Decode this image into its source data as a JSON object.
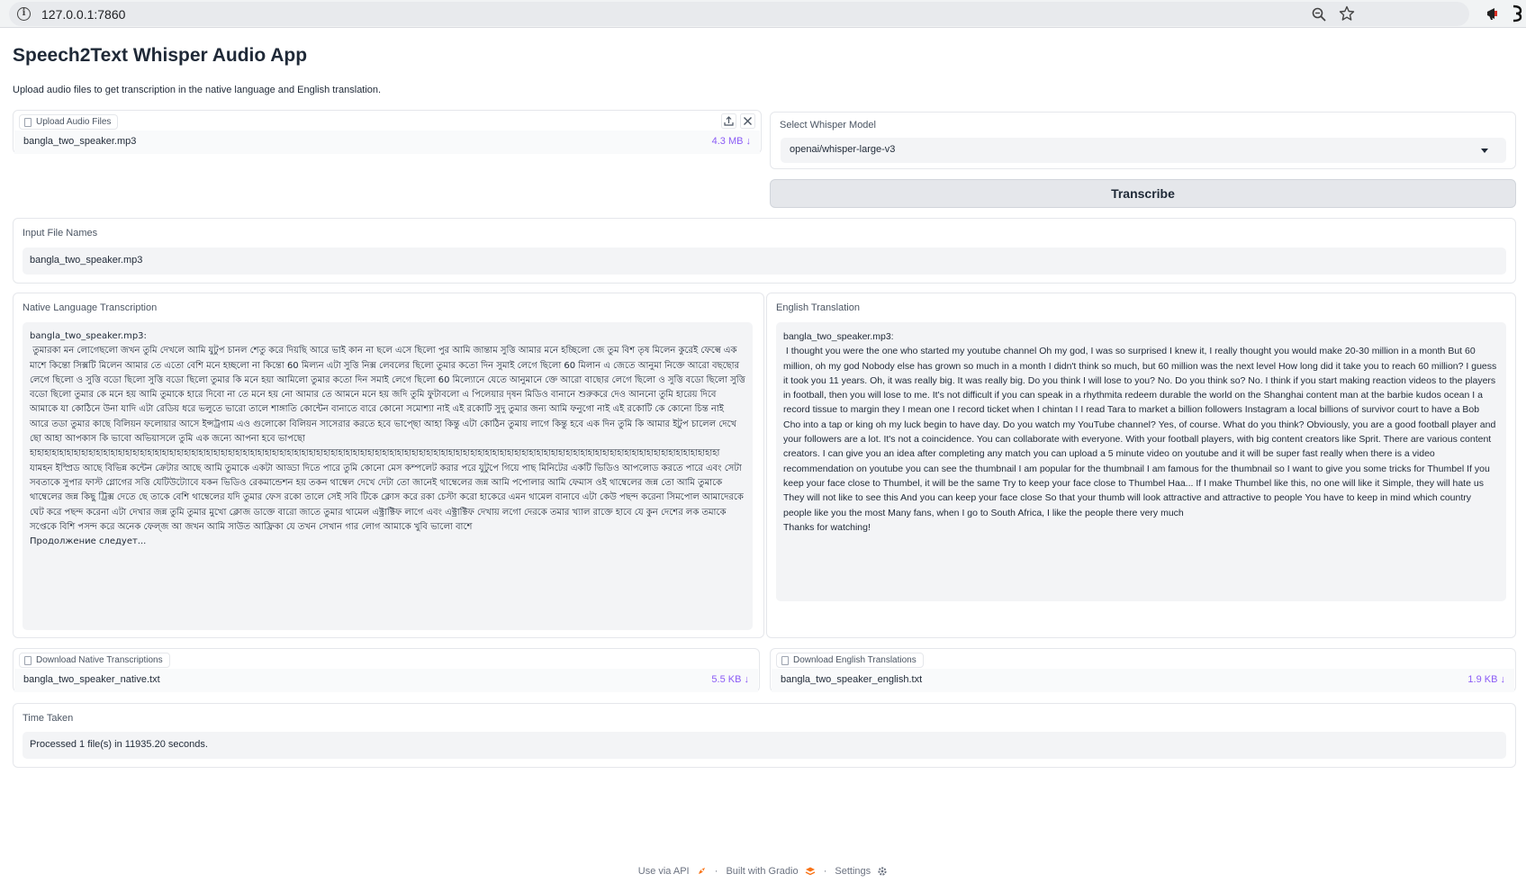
{
  "browser": {
    "url": "127.0.0.1:7860"
  },
  "app": {
    "title": "Speech2Text Whisper Audio App",
    "description": "Upload audio files to get transcription in the native language and English translation."
  },
  "upload": {
    "label": "Upload Audio Files",
    "file_name": "bangla_two_speaker.mp3",
    "file_size": "4.3 MB ↓"
  },
  "model": {
    "label": "Select Whisper Model",
    "selected": "openai/whisper-large-v3"
  },
  "transcribe_button": "Transcribe",
  "input_files": {
    "label": "Input File Names",
    "value": "bangla_two_speaker.mp3"
  },
  "native": {
    "label": "Native Language Transcription",
    "value": "bangla_two_speaker.mp3:\n তুমারকা মন লোগেছলো জখন তুমি দেখলে আমি যুটুপ চানল শেতু করে দিয়ছি আরে ভাই কান না ছলে এসে ছিলো পুর আমি জান্তাম সুত্তি আমার মনে হচ্ছিলো জে তুম বিশ তৃষ মিলেন কুরেই ফেল্বে এক মাশে কিন্তো সিক্সটি মিলেন আমার তে এতো বেশি মনে হচ্ছলো না কিন্তো 60 মিল্যন এটা সুত্তি নিক্স লেবলের ছিলো তুমার কতো দিন সুমাই লেগে ছিলো 60 মিলান এ জেতে আনুমা নিক্তে আরো বছছোর লেগে ছিলো ও সুত্তি বডো ছিলো সুত্তি বডো ছিলো তুমার কি মনে হয়া আমিলো তুমার কতো দিন সমাই লেগে ছিলো 60 মিল্যোনে যেতে আনুমানে ক্তে আরো বাছোর লেগে ছিলো ও সুত্তি বডো ছিলো সুত্তি বডো ছিলো তুমার কে মনে হয় আমি তুমাকে হারে দিবো না তে মনে হয় নো আমার তে আমনে মনে হয় জদি তুমি ফুটাবলো এ পিলেয়ার দৃষন মিডিও বানানে শুরুকরে দেও আননো তুমি হারেয় দিবে আমাকে যা কোঠিনে উনা যাদি এটা রেডিয় ধরে ভলুতে ভারো তালে শাঙ্গাতি কোন্টেন বানাতে বারে কোনো সমোশ্যা নাই এই রকোটি সুদু তুমার জন্য আমি ফনুগো নাই এই রকোটি কে কোনো চিন্ত নাই আরে তডা তুমার কাছে বিলিয়ন ফলোয়ার আসে ইন্সট্রগাম এও গুলোকো বিলিয়ন সাসেরার করতে হবে ভাপ্ছো আহা কিন্তু এটা কোঠিন তুমায় লাগে কিন্তু হবে এক দিন তুমি কি আমার ইটুপ চালেল দেখে ছো আহা আপকাস কি ভাবো অভিয়াসলে তুমি এক জন্যে আপনা হবে ভাপছো\nহাহাহাহাহাহাহাহাহাহাহাহাহাহাহাহাহাহাহাহাহাহাহাহাহাহাহাহাহাহাহাহাহাহাহাহাহাহাহাহাহাহাহাহাহাহাহাহাহাহাহাহাহাহাহাহাহাহাহাহাহাহাহাহাহাহাহাহাহাহাহাহাহাহাহাহাহাহাহাহাহাহাহাহাহাহাহাহাহাহাহাহাহাহা যামহন ইস্প্রিড আছে বিভিন্ন কন্টেন ক্রেটার আছে আমি তুমাকে একটা আড্ডা দিতে পারে তুমি কোনো মেস কম্পলেট করার পরে যুটুপে গিয়ে পাছ মিনিটের একটি ভিডিও আপলোড করতে পারে এবং সেটা সবতাকে সুপার ফাস্ট গ্লোগের সত্তি যেটিউট্যোবে যকন ভিডিও রেকমান্ডেশন হয় তকন থাম্বেল দেখে দেটা তো জানেই থাম্বেলের জন্ন আমি পপোলার আমি ফেমাস ওই থাম্বেলের জন্ন তো আমি তুমাকে থাম্বেলের জন্ন কিছু ট্রিক্স দেতে ছে তাকে বেশি থাম্বেলের যদি তুমার ফেস রকো তালে সেই সবি টিকে ক্লোস করে রকা চেস্টা করো হাকেরে এমন থামেল বানাবে এটা কেউ পছন্দ করেনা সিমপোল আমাদেরকে ঘেট করে পছন্দ করেনা এটা দেখার জন্ন তুমি তুমার মুখো ক্লোজ ডাক্তে বারো জাতে তুমার থামেল এক্ট্রাক্টিফ লাগে এবং এক্ট্রাক্টিফ দেখায় লগো দেরকে তমার খ্যাল রাক্তে হাবে যে কুন দেশের লক তমাকে সপ্তেকে বিশি পসন্দ করে অনেক ফেল্জ আ জখন আমি সাউত আফ্রিকা যে তখন সেখান গার লোগ আমাকে খুবি ভালো বাশে\nПродолжение следует..."
  },
  "english": {
    "label": "English Translation",
    "value": "bangla_two_speaker.mp3:\n I thought you were the one who started my youtube channel Oh my god, I was so surprised I knew it, I really thought you would make 20-30 million in a month But 60 million, oh my god Nobody else has grown so much in a month I didn't think so much, but 60 million was the next level How long did it take you to reach 60 million? I guess it took you 11 years. Oh, it was really big. It was really big. Do you think I will lose to you? No. Do you think so? No. I think if you start making reaction videos to the players in football, then you will lose to me. It's not difficult if you can speak in a rhythmita redeem durable the world on the Shanghai content man at the barbie kudos ocean I a record tissue to margin they I mean one I record ticket when I chintan I I read Tara to market a billion followers Instagram a local billions of survivor court to have a Bob Cho into a tap or king oh my luck begin to have day. Do you watch my YouTube channel? Yes, of course. What do you think? Obviously, you are a good football player and your followers are a lot. It's not a coincidence. You can collaborate with everyone. With your football players, with big content creators like Sprit. There are various content creators. I can give you an idea after completing any match you can upload a 5 minute video on youtube and it will be super fast really when there is a video recommendation on youtube you can see the thumbnail I am popular for the thumbnail I am famous for the thumbnail so I want to give you some tricks for Thumbel If you keep your face close to Thumbel, it will be the same Try to keep your face close to Thumbel Haa... If I make Thumbel like this, no one will like it Simple, they will hate us They will not like to see this And you can keep your face close So that your thumb will look attractive and attractive to people You have to keep in mind which country people like you the most Many fans, when I go to South Africa, I like the people there very much\nThanks for watching!"
  },
  "download_native": {
    "label": "Download Native Transcriptions",
    "file_name": "bangla_two_speaker_native.txt",
    "file_size": "5.5 KB ↓"
  },
  "download_english": {
    "label": "Download English Translations",
    "file_name": "bangla_two_speaker_english.txt",
    "file_size": "1.9 KB ↓"
  },
  "time_taken": {
    "label": "Time Taken",
    "value": "Processed 1 file(s) in 11935.20 seconds."
  },
  "footer": {
    "api": "Use via API",
    "built": "Built with Gradio",
    "settings": "Settings",
    "separator": "·"
  }
}
